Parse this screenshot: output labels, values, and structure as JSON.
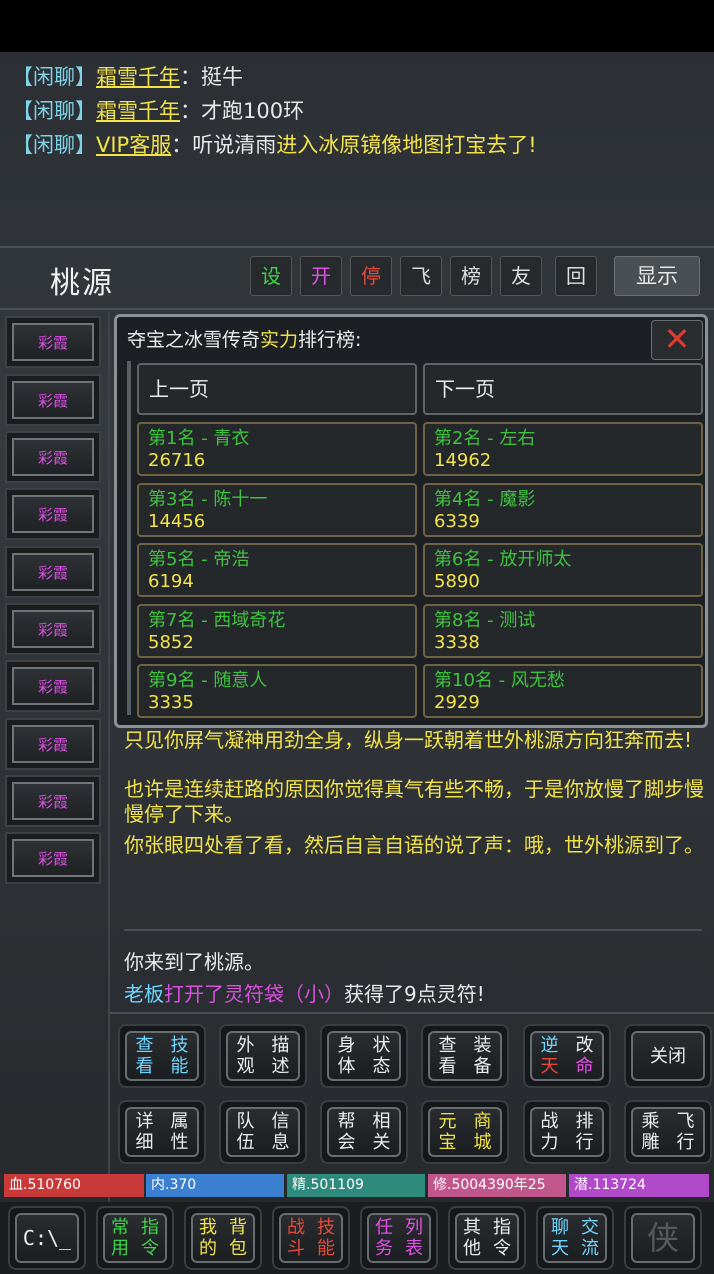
{
  "chat": [
    {
      "channel": "【闲聊】",
      "speaker": "霜雪千年",
      "sep": "：",
      "text": "挺牛",
      "hl": ""
    },
    {
      "channel": "【闲聊】",
      "speaker": "霜雪千年",
      "sep": "：",
      "text": "才跑100环",
      "hl": ""
    },
    {
      "channel": "【闲聊】",
      "speaker": "VIP客服",
      "sep": "：",
      "text": "听说清雨",
      "hl": "进入冰原镜像地图打宝去了!"
    }
  ],
  "location": {
    "title": "桃源",
    "toolbar": [
      {
        "label": "设",
        "color": "#3fd24a"
      },
      {
        "label": "开",
        "color": "#e24fe6"
      },
      {
        "label": "停",
        "color": "#e64a3a"
      },
      {
        "label": "飞",
        "color": "#e8e8e8"
      },
      {
        "label": "榜",
        "color": "#e8e8e8"
      },
      {
        "label": "友",
        "color": "#e8e8e8"
      },
      {
        "label": "回",
        "color": "#e8e8e8"
      }
    ],
    "show_label": "显示"
  },
  "side_buttons": [
    "彩霞",
    "彩霞",
    "彩霞",
    "彩霞",
    "彩霞",
    "彩霞",
    "彩霞",
    "彩霞",
    "彩霞",
    "彩霞"
  ],
  "ranking": {
    "title_pre": "夺宝之冰雪传奇",
    "title_hl": "实力",
    "title_post": "排行榜:",
    "close": "✕",
    "prev": "上一页",
    "next": "下一页",
    "entries": [
      {
        "name": "第1名 - 青衣",
        "value": "26716"
      },
      {
        "name": "第2名 - 左右",
        "value": "14962"
      },
      {
        "name": "第3名 - 陈十一",
        "value": "14456"
      },
      {
        "name": "第4名 - 魔影",
        "value": "6339"
      },
      {
        "name": "第5名 - 帝浩",
        "value": "6194"
      },
      {
        "name": "第6名 - 放开师太",
        "value": "5890"
      },
      {
        "name": "第7名 - 西域奇花",
        "value": "5852"
      },
      {
        "name": "第8名 - 测试",
        "value": "3338"
      },
      {
        "name": "第9名 - 随意人",
        "value": "3335"
      },
      {
        "name": "第10名 - 风无愁",
        "value": "2929"
      }
    ]
  },
  "story": {
    "p1": "只见你屏气凝神用劲全身，纵身一跃朝着世外桃源方向狂奔而去!",
    "p2": "也许是连续赶路的原因你觉得真气有些不畅，于是你放慢了脚步慢慢停了下来。",
    "p3": "你张眼四处看了看，然后自言自语的说了声：哦，世外桃源到了。",
    "arrive": "你来到了桃源。",
    "loot_who": "老板",
    "loot_action": "打开了",
    "loot_item": "灵符袋（小）",
    "loot_result": "获得了9点灵符!"
  },
  "actions": [
    {
      "l1": "查看",
      "l2": "技能",
      "c1": "#6fd6ff",
      "c2": "#6fd6ff"
    },
    {
      "l1": "外观",
      "l2": "描述",
      "c1": "#ececec",
      "c2": "#ececec"
    },
    {
      "l1": "身体",
      "l2": "状态",
      "c1": "#ececec",
      "c2": "#ececec"
    },
    {
      "l1": "查看",
      "l2": "装备",
      "c1": "#ececec",
      "c2": "#ececec"
    },
    {
      "l1": "逆天",
      "l2": "改命",
      "c1": "#e64a3a",
      "c2": "#e64a3a"
    },
    {
      "l1": "关",
      "l2": "闭",
      "c1": "#ececec",
      "c2": "#ececec"
    },
    {
      "l1": "详细",
      "l2": "属性",
      "c1": "#ececec",
      "c2": "#ececec"
    },
    {
      "l1": "队伍",
      "l2": "信息",
      "c1": "#ececec",
      "c2": "#ececec"
    },
    {
      "l1": "帮会",
      "l2": "相关",
      "c1": "#ececec",
      "c2": "#ececec"
    },
    {
      "l1": "元宝",
      "l2": "商城",
      "c1": "#f2e34a",
      "c2": "#f2e34a"
    },
    {
      "l1": "战力",
      "l2": "排行",
      "c1": "#ececec",
      "c2": "#ececec"
    },
    {
      "l1": "乘雕",
      "l2": "飞行",
      "c1": "#ececec",
      "c2": "#ececec"
    }
  ],
  "stats": [
    {
      "label": "血.510760",
      "color": "#c83a3a"
    },
    {
      "label": "内.370",
      "color": "#3a7fd0"
    },
    {
      "label": "精.501109",
      "color": "#2e8a7a"
    },
    {
      "label": "修.5004390年25",
      "color": "#c0568a"
    },
    {
      "label": "潜.113724",
      "color": "#b04ac8"
    }
  ],
  "nav": [
    {
      "l1": "C:\\_",
      "l2": "",
      "color": "#ececec"
    },
    {
      "l1": "常用",
      "l2": "指令",
      "color": "#3fd24a"
    },
    {
      "l1": "我的",
      "l2": "背包",
      "color": "#f2e34a"
    },
    {
      "l1": "战斗",
      "l2": "技能",
      "color": "#e64a3a"
    },
    {
      "l1": "任务",
      "l2": "列表",
      "color": "#e24fe6"
    },
    {
      "l1": "其他",
      "l2": "指令",
      "color": "#ececec"
    },
    {
      "l1": "聊天",
      "l2": "交流",
      "color": "#6fd6ff"
    },
    {
      "l1": "侠",
      "l2": "",
      "color": "#555a5e"
    }
  ]
}
